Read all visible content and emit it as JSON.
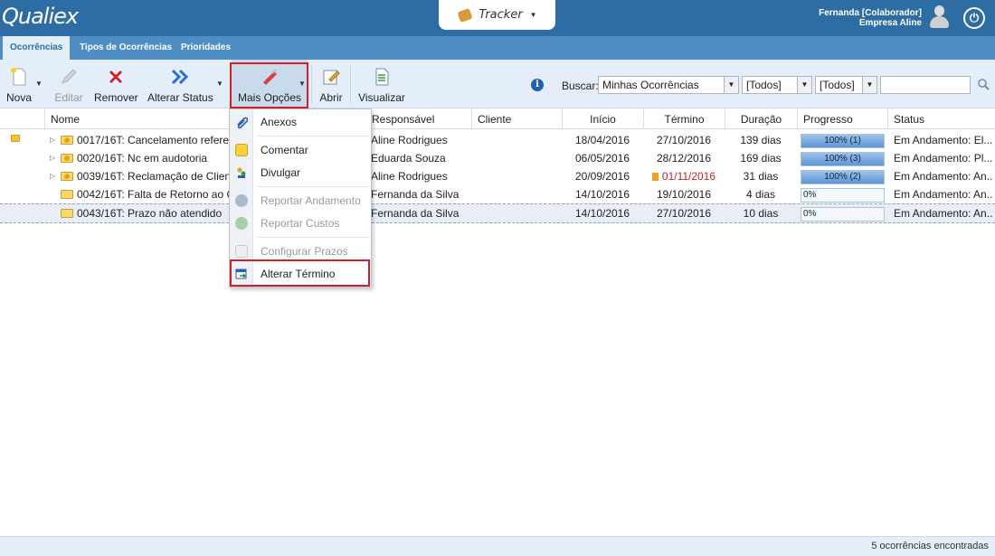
{
  "header": {
    "logo": "Qualiex",
    "product_name": "Tracker",
    "user_name": "Fernanda [Colaborador]",
    "company": "Empresa Aline"
  },
  "tabs": [
    {
      "label": "Ocorrências"
    },
    {
      "label": "Tipos de Ocorrências"
    },
    {
      "label": "Prioridades"
    }
  ],
  "toolbar": {
    "nova": "Nova",
    "editar": "Editar",
    "remover": "Remover",
    "alterar_status": "Alterar Status",
    "mais_opcoes": "Mais Opções",
    "abrir": "Abrir",
    "visualizar": "Visualizar",
    "buscar_label": "Buscar:",
    "filter1": "Minhas Ocorrências",
    "filter2": "[Todos]",
    "filter3": "[Todos]",
    "search_value": ""
  },
  "columns": {
    "nome": "Nome",
    "responsavel": "Responsável",
    "cliente": "Cliente",
    "inicio": "Início",
    "termino": "Término",
    "duracao": "Duração",
    "progresso": "Progresso",
    "status": "Status"
  },
  "rows": [
    {
      "nome": "0017/16T: Cancelamento referente",
      "responsavel": "Aline Rodrigues",
      "cliente": "",
      "inicio": "18/04/2016",
      "termino": "27/10/2016",
      "duracao": "139 dias",
      "progress": 1.0,
      "progresso": "100% (1)",
      "status": "Em Andamento: El..."
    },
    {
      "nome": "0020/16T: Nc em audotoria",
      "responsavel": "Eduarda Souza",
      "cliente": "",
      "inicio": "06/05/2016",
      "termino": "28/12/2016",
      "duracao": "169 dias",
      "progress": 1.0,
      "progresso": "100% (3)",
      "status": "Em Andamento: Pl..."
    },
    {
      "nome": "0039/16T: Reclamação de Cliente",
      "responsavel": "Aline Rodrigues",
      "cliente": "",
      "inicio": "20/09/2016",
      "termino": "01/11/2016",
      "duracao": "31 dias",
      "progress": 1.0,
      "progresso": "100% (2)",
      "status": "Em Andamento: An..."
    },
    {
      "nome": "0042/16T: Falta de Retorno ao Cli",
      "responsavel": "Fernanda da Silva",
      "cliente": "",
      "inicio": "14/10/2016",
      "termino": "19/10/2016",
      "duracao": "4 dias",
      "progress": 0.0,
      "progresso": "0%",
      "status": "Em Andamento: An..."
    },
    {
      "nome": "0043/16T: Prazo não atendido",
      "responsavel": "Fernanda da Silva",
      "cliente": "",
      "inicio": "14/10/2016",
      "termino": "27/10/2016",
      "duracao": "10 dias",
      "progress": 0.0,
      "progresso": "0%",
      "status": "Em Andamento: An..."
    }
  ],
  "menu": {
    "anexos": "Anexos",
    "comentar": "Comentar",
    "divulgar": "Divulgar",
    "reportar_andamento": "Reportar Andamento",
    "reportar_custos": "Reportar Custos",
    "configurar_prazos": "Configurar Prazos",
    "alterar_termino": "Alterar Término"
  },
  "status_bar": {
    "count_text": "5 ocorrências encontradas"
  },
  "colors": {
    "header_bg": "#2d6da3",
    "tabbar_bg": "#4f8ec4",
    "toolbar_bg": "#e3eef8",
    "highlight_border": "#d0202a",
    "overdue_text": "#d12020"
  }
}
